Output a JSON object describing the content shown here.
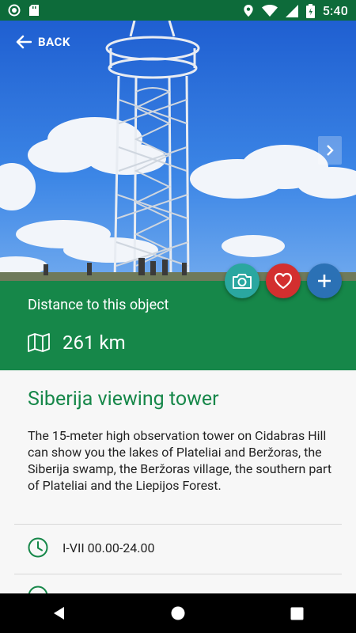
{
  "status_bar": {
    "time": "5:40",
    "icons": [
      "circle-status-icon",
      "sd-card-icon",
      "location-icon",
      "wifi-icon",
      "signal-icon",
      "battery-icon"
    ]
  },
  "header": {
    "back_label": "BACK"
  },
  "distance": {
    "label": "Distance to this object",
    "value": "261 km",
    "icon": "map-icon"
  },
  "actions": {
    "camera_icon": "camera-icon",
    "favorite_icon": "heart-icon",
    "add_icon": "plus-icon"
  },
  "object": {
    "title": "Siberija viewing tower",
    "description": "The 15-meter high observation tower on Cidabras Hill can show you the lakes of Plateliai and Beržoras, the Siberija swamp, the Beržoras village, the southern part of Plateliai and the Liepijos Forest.",
    "hours": "I-VII 00.00-24.00"
  },
  "colors": {
    "primary": "#168749",
    "status_bar": "#0d6b3a",
    "camera_fab": "#2aa7a0",
    "favorite_fab": "#d32f2f",
    "add_fab": "#2b71b5"
  }
}
